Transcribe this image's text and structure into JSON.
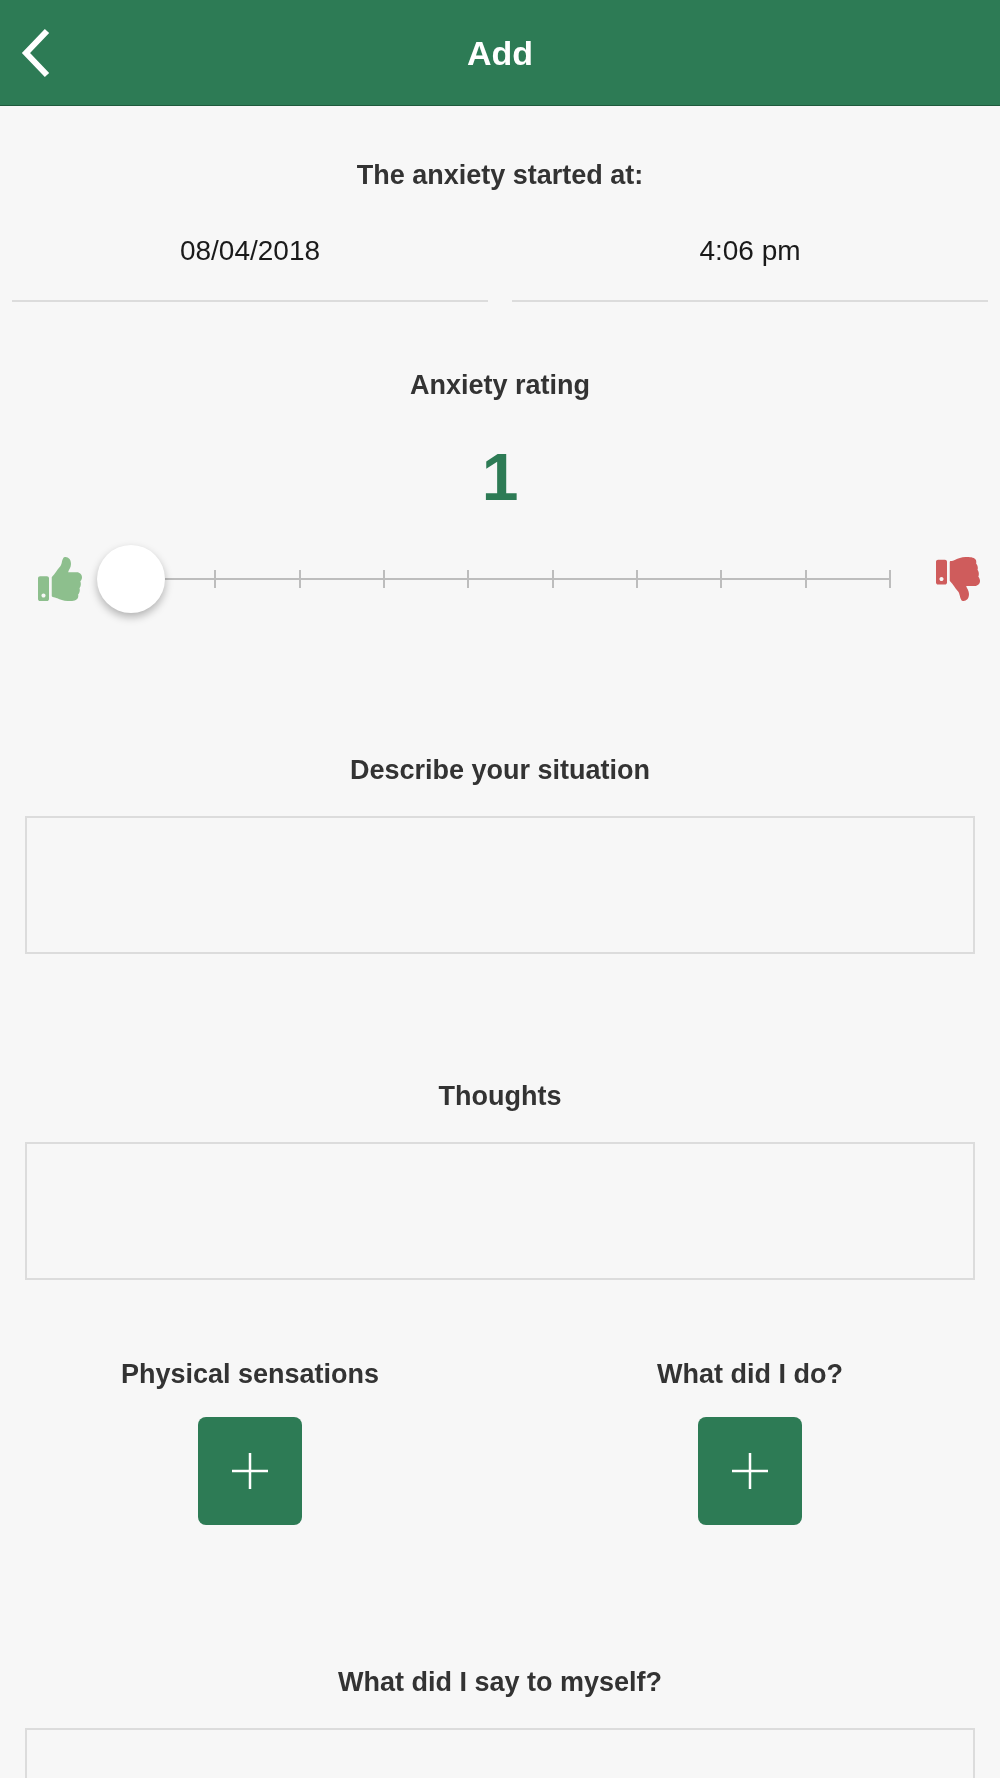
{
  "header": {
    "title": "Add"
  },
  "start": {
    "label": "The anxiety started at:",
    "date": "08/04/2018",
    "time": "4:06 pm"
  },
  "rating": {
    "label": "Anxiety rating",
    "value": "1",
    "level": 0
  },
  "sections": [
    {
      "kind": "text",
      "label": "Describe your situation"
    },
    {
      "kind": "text",
      "label": "Thoughts"
    },
    {
      "kind": "pair",
      "items": [
        {
          "label": "Physical sensations"
        },
        {
          "label": "What did I do?"
        }
      ]
    },
    {
      "kind": "text",
      "label": "What did I say to myself?"
    }
  ]
}
